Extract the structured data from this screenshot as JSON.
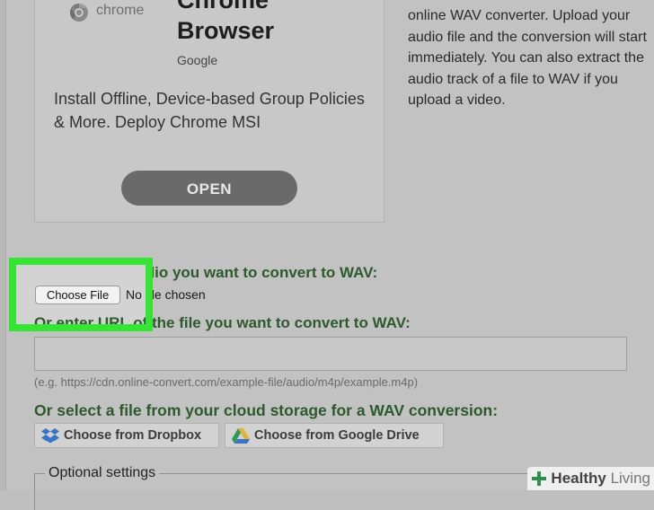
{
  "ad": {
    "chrome_word": "chrome",
    "title": "Chrome\nBrowser",
    "brand": "Google",
    "description": "Install Offline, Device-based Group Policies & More. Deploy Chrome MSI",
    "open_label": "OPEN"
  },
  "right_description": "online WAV converter. Upload your audio file and the conversion will start immediately. You can also extract the audio track of a file to WAV if you upload a video.",
  "upload": {
    "heading": "Upload your audio you want to convert to WAV:",
    "choose_file_label": "Choose File",
    "no_file_text": "No file chosen"
  },
  "url": {
    "heading": "Or enter URL of the file you want to convert to WAV:",
    "value": "",
    "hint": "(e.g. https://cdn.online-convert.com/example-file/audio/m4p/example.m4p)"
  },
  "cloud": {
    "heading": "Or select a file from your cloud storage for a WAV conversion:",
    "dropbox_label": "Choose from Dropbox",
    "gdrive_label": "Choose from Google Drive"
  },
  "optional": {
    "label": "Optional settings"
  },
  "watermark": {
    "word1": "Healthy",
    "word2": "Living"
  },
  "colors": {
    "highlight": "#34e534",
    "heading_green": "#2d5a2d",
    "dropbox_blue": "#3a74c4"
  },
  "icons": [
    "chrome-logo-icon",
    "dropbox-icon",
    "google-drive-icon",
    "healthy-living-plus-icon"
  ]
}
